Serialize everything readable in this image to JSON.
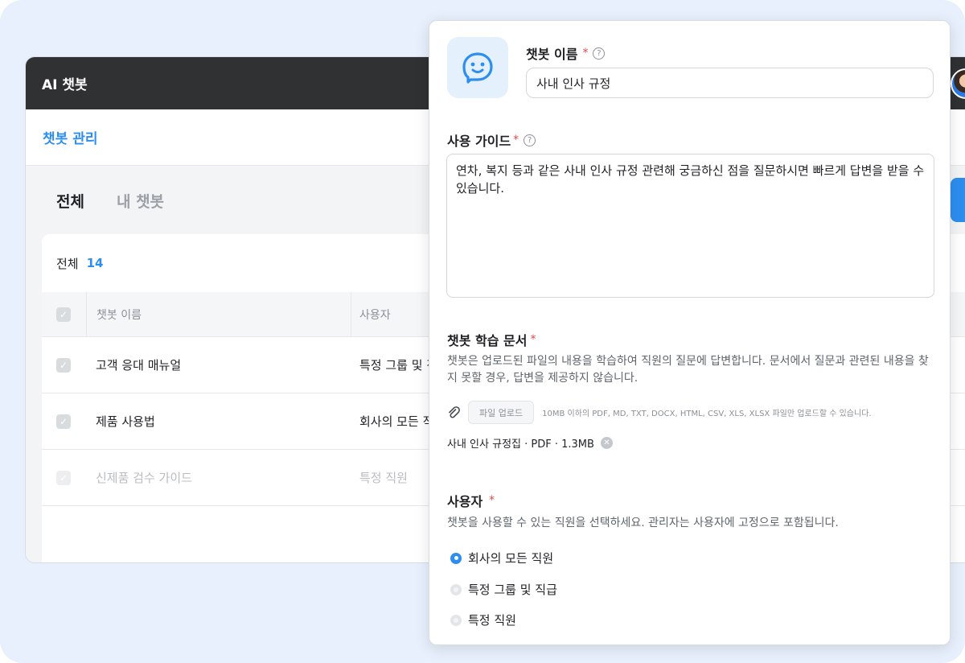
{
  "app": {
    "title": "AI 챗봇",
    "section_title": "챗봇 관리"
  },
  "tabs": [
    {
      "label": "전체",
      "active": true
    },
    {
      "label": "내 챗봇",
      "active": false
    }
  ],
  "list": {
    "count_label": "전체",
    "count": "14",
    "columns": [
      "챗봇 이름",
      "사용자"
    ],
    "rows": [
      {
        "name": "고객 응대 매뉴얼",
        "user": "특정 그룹 및 직",
        "disabled": false
      },
      {
        "name": "제품 사용법",
        "user": "회사의 모든 직",
        "disabled": false
      },
      {
        "name": "신제품 검수 가이드",
        "user": "특정 직원",
        "disabled": true
      }
    ]
  },
  "form": {
    "name_label": "챗봇 이름",
    "name_value": "사내 인사 규정",
    "guide_label": "사용 가이드",
    "guide_value": "연차, 복지 등과 같은 사내 인사 규정 관련해 궁금하신 점을 질문하시면 빠르게 답변을 받을 수 있습니다.",
    "docs_label": "챗봇 학습 문서",
    "docs_desc": "챗봇은 업로드된 파일의 내용을 학습하여 직원의 질문에 답변합니다. 문서에서 질문과 관련된 내용을 찾지 못할 경우, 답변을 제공하지 않습니다.",
    "upload_button": "파일 업로드",
    "upload_hint": "10MB 이하의 PDF, MD, TXT, DOCX, HTML, CSV, XLS, XLSX 파일만 업로드할 수 있습니다.",
    "file": "사내 인사 규정집 · PDF · 1.3MB",
    "users_label": "사용자",
    "users_desc": "챗봇을 사용할 수 있는 직원을 선택하세요. 관리자는 사용자에 고정으로 포함됩니다.",
    "options": [
      {
        "label": "회사의 모든 직원",
        "selected": true
      },
      {
        "label": "특정 그룹 및 직급",
        "selected": false
      },
      {
        "label": "특정 직원",
        "selected": false
      }
    ],
    "required_mark": "*",
    "help_mark": "?"
  },
  "colors": {
    "accent": "#2d8ef0",
    "header_bg": "#303133",
    "required": "#e5484d",
    "background": "#e7f0fc"
  },
  "icons": [
    "chatbot-face-icon",
    "help-icon",
    "paperclip-icon",
    "remove-file-icon",
    "check-icon"
  ]
}
